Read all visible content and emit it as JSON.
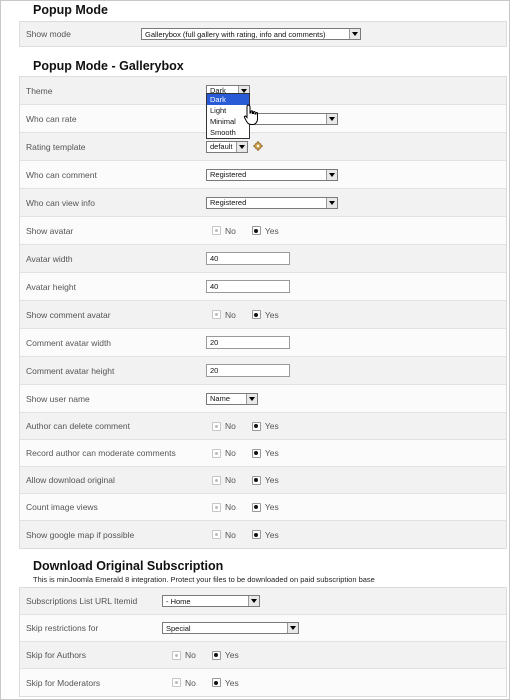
{
  "sections": {
    "popup_mode": {
      "title": "Popup Mode"
    },
    "gallerybox": {
      "title": "Popup Mode - Gallerybox"
    },
    "download": {
      "title": "Download Original Subscription",
      "note": "This is minJoomla Emerald 8 integration. Protect your files to be downloaded on paid subscription base"
    }
  },
  "popup_mode": {
    "show_mode_label": "Show mode",
    "show_mode_value": "Gallerybox (full gallery with rating, info and comments)"
  },
  "gallerybox": {
    "theme": {
      "label": "Theme",
      "value": "Dark",
      "options": [
        "Dark",
        "Light",
        "Minimal",
        "Smooth"
      ]
    },
    "who_can_rate": {
      "label": "Who can rate",
      "value": ""
    },
    "rating_template": {
      "label": "Rating template",
      "value": "default"
    },
    "who_can_comment": {
      "label": "Who can comment",
      "value": "Registered"
    },
    "who_can_view_info": {
      "label": "Who can view info",
      "value": "Registered"
    },
    "show_avatar": {
      "label": "Show avatar",
      "no": "No",
      "yes": "Yes"
    },
    "avatar_width": {
      "label": "Avatar width",
      "value": "40"
    },
    "avatar_height": {
      "label": "Avatar height",
      "value": "40"
    },
    "show_comment_avatar": {
      "label": "Show comment avatar",
      "no": "No",
      "yes": "Yes"
    },
    "comment_avatar_width": {
      "label": "Comment avatar width",
      "value": "20"
    },
    "comment_avatar_height": {
      "label": "Comment avatar height",
      "value": "20"
    },
    "show_user_name": {
      "label": "Show user name",
      "value": "Name"
    },
    "author_can_delete": {
      "label": "Author can delete comment",
      "no": "No",
      "yes": "Yes"
    },
    "record_author_moderate": {
      "label": "Record author can moderate comments",
      "no": "No",
      "yes": "Yes"
    },
    "allow_download": {
      "label": "Allow download original",
      "no": "No",
      "yes": "Yes"
    },
    "count_views": {
      "label": "Count image views",
      "no": "No",
      "yes": "Yes"
    },
    "show_google_map": {
      "label": "Show google map if possible",
      "no": "No",
      "yes": "Yes"
    }
  },
  "download": {
    "subscriptions_itemid": {
      "label": "Subscriptions List URL Itemid",
      "value": "- Home"
    },
    "skip_restrictions": {
      "label": "Skip restrictions for",
      "value": "Special"
    },
    "skip_authors": {
      "label": "Skip for Authors",
      "no": "No",
      "yes": "Yes"
    },
    "skip_moderators": {
      "label": "Skip for Moderators",
      "no": "No",
      "yes": "Yes"
    }
  }
}
